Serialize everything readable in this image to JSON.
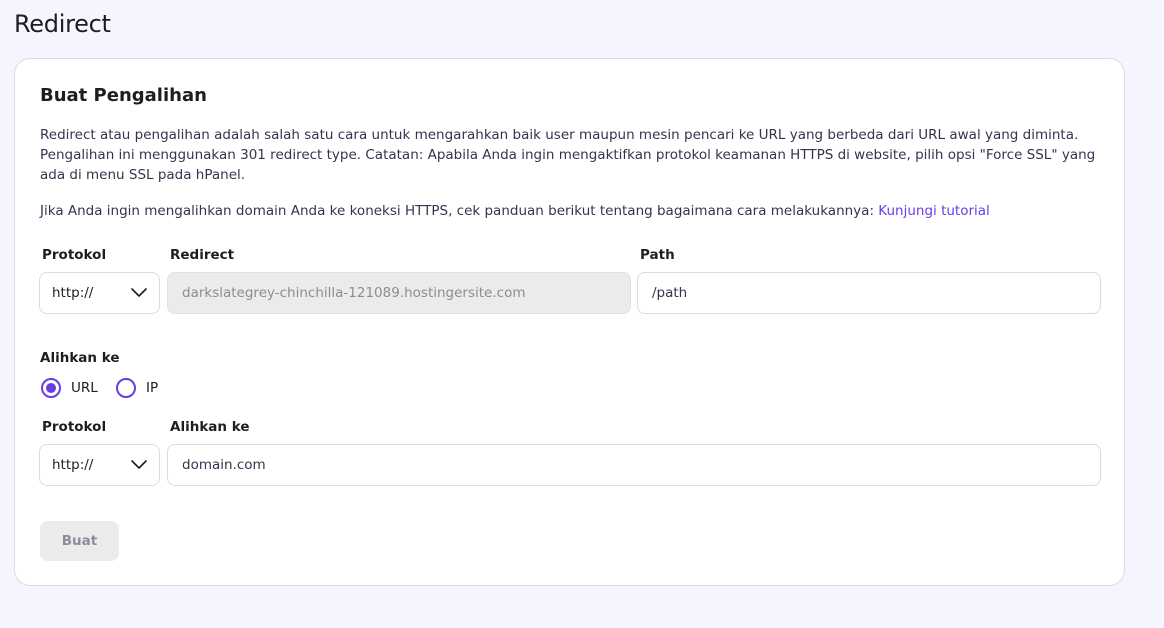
{
  "page": {
    "title": "Redirect"
  },
  "card": {
    "title": "Buat Pengalihan",
    "description": "Redirect atau pengalihan adalah salah satu cara untuk mengarahkan baik user maupun mesin pencari ke URL yang berbeda dari URL awal yang diminta. Pengalihan ini menggunakan 301 redirect type. Catatan: Apabila Anda ingin mengaktifkan protokol keamanan HTTPS di website, pilih opsi \"Force SSL\" yang ada di menu SSL pada hPanel.",
    "https_note": "Jika Anda ingin mengalihkan domain Anda ke koneksi HTTPS, cek panduan berikut tentang bagaimana cara melakukannya:",
    "tutorial_link": "Kunjungi tutorial"
  },
  "source": {
    "protocol_label": "Protokol",
    "protocol_value": "http://",
    "redirect_label": "Redirect",
    "redirect_value": "darkslategrey-chinchilla-121089.hostingersite.com",
    "path_label": "Path",
    "path_placeholder": "/path"
  },
  "target": {
    "section_label": "Alihkan ke",
    "options": [
      {
        "label": "URL",
        "selected": true
      },
      {
        "label": "IP",
        "selected": false
      }
    ],
    "protocol_label": "Protokol",
    "protocol_value": "http://",
    "target_label": "Alihkan ke",
    "target_placeholder": "domain.com"
  },
  "actions": {
    "submit_label": "Buat"
  },
  "colors": {
    "accent": "#673de6",
    "disabled_bg": "#ebebeb",
    "disabled_text": "#8c8c96"
  }
}
